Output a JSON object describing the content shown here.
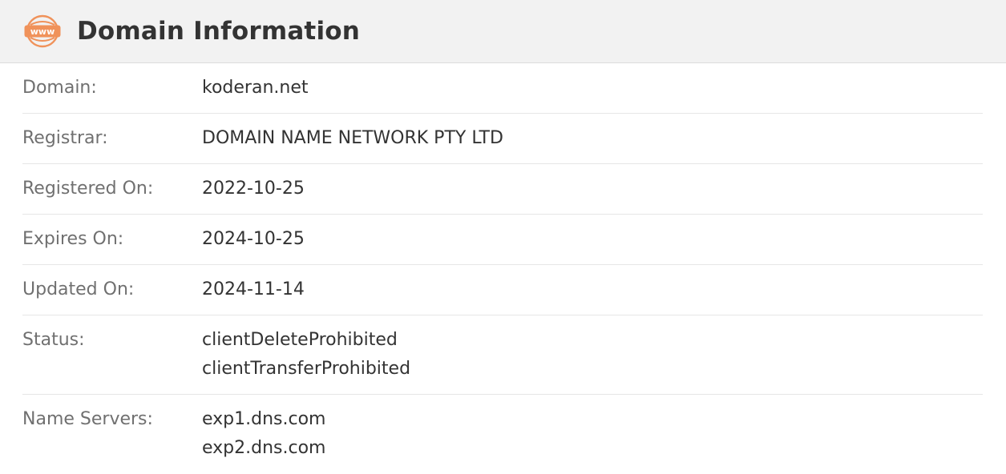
{
  "header": {
    "icon": "www-icon",
    "icon_text": "www",
    "title": "Domain Information",
    "accent_color": "#f0925a"
  },
  "rows": [
    {
      "label": "Domain:",
      "values": [
        "koderan.net"
      ]
    },
    {
      "label": "Registrar:",
      "values": [
        "DOMAIN NAME NETWORK PTY LTD"
      ]
    },
    {
      "label": "Registered On:",
      "values": [
        "2022-10-25"
      ]
    },
    {
      "label": "Expires On:",
      "values": [
        "2024-10-25"
      ]
    },
    {
      "label": "Updated On:",
      "values": [
        "2024-11-14"
      ]
    },
    {
      "label": "Status:",
      "values": [
        "clientDeleteProhibited",
        "clientTransferProhibited"
      ]
    },
    {
      "label": "Name Servers:",
      "values": [
        "exp1.dns.com",
        "exp2.dns.com"
      ]
    }
  ]
}
